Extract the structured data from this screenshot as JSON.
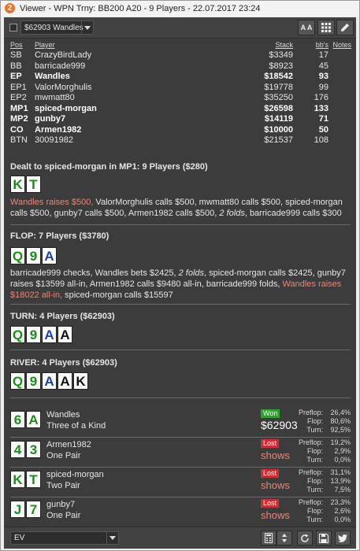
{
  "window": {
    "title": "Viewer - WPN Trny: BB200 A20 - 9 Players - 22.07.2017 23:24",
    "app_icon": "2"
  },
  "toolbar": {
    "hand_select": "$62903 Wandles",
    "btn_aa": "A A"
  },
  "table_header": {
    "pos": "Pos",
    "player": "Player",
    "stack": "Stack",
    "bbs": "bb's",
    "notes": "Notes"
  },
  "players": [
    {
      "pos": "SB",
      "name": "CrazyBirdLady",
      "stack": "$3349",
      "bbs": "17",
      "bold": false
    },
    {
      "pos": "BB",
      "name": "barricade999",
      "stack": "$8923",
      "bbs": "45",
      "bold": false
    },
    {
      "pos": "EP",
      "name": "Wandles",
      "stack": "$18542",
      "bbs": "93",
      "bold": true
    },
    {
      "pos": "EP1",
      "name": "ValorMorghulis",
      "stack": "$19778",
      "bbs": "99",
      "bold": false
    },
    {
      "pos": "EP2",
      "name": "mwmatt80",
      "stack": "$35250",
      "bbs": "176",
      "bold": false
    },
    {
      "pos": "MP1",
      "name": "spiced-morgan",
      "stack": "$26598",
      "bbs": "133",
      "bold": true
    },
    {
      "pos": "MP2",
      "name": "gunby7",
      "stack": "$14119",
      "bbs": "71",
      "bold": true
    },
    {
      "pos": "CO",
      "name": "Armen1982",
      "stack": "$10000",
      "bbs": "50",
      "bold": true
    },
    {
      "pos": "BTN",
      "name": "30091982",
      "stack": "$21537",
      "bbs": "108",
      "bold": false
    }
  ],
  "preflop": {
    "header": "Dealt to spiced-morgan in MP1: 9 Players ($280)",
    "cards": [
      {
        "r": "K",
        "s": "c"
      },
      {
        "r": "T",
        "s": "c"
      }
    ],
    "act_red": "Wandles raises $500,",
    "act_a": " ValorMorghulis calls $500, mwmatt80 calls $500, spiced-morgan calls $500, gunby7 calls $500, Armen1982 calls $500, ",
    "act_it": "2 folds",
    "act_b": ", barricade999 calls $300"
  },
  "flop": {
    "header": "FLOP: 7 Players ($3780)",
    "cards": [
      {
        "r": "Q",
        "s": "c"
      },
      {
        "r": "9",
        "s": "c"
      },
      {
        "r": "A",
        "s": "d"
      }
    ],
    "act_a": "barricade999 checks, Wandles bets $2425, ",
    "act_it": "2 folds",
    "act_b": ", spiced-morgan calls $2425, gunby7 raises $13599 all-in, Armen1982 calls $9480 all-in, barricade999 folds, ",
    "act_red": "Wandles raises $18022 all-in,",
    "act_c": " spiced-morgan calls $15597"
  },
  "turn": {
    "header": "TURN: 4 Players ($62903)",
    "cards": [
      {
        "r": "Q",
        "s": "c"
      },
      {
        "r": "9",
        "s": "c"
      },
      {
        "r": "A",
        "s": "d"
      },
      {
        "r": "A",
        "s": "s"
      }
    ]
  },
  "river": {
    "header": "RIVER: 4 Players ($62903)",
    "cards": [
      {
        "r": "Q",
        "s": "c"
      },
      {
        "r": "9",
        "s": "c"
      },
      {
        "r": "A",
        "s": "d"
      },
      {
        "r": "A",
        "s": "s"
      },
      {
        "r": "K",
        "s": "s"
      }
    ]
  },
  "results": [
    {
      "cards": [
        {
          "r": "6",
          "s": "c"
        },
        {
          "r": "A",
          "s": "c"
        }
      ],
      "name": "Wandles",
      "hand": "Three of a Kind",
      "status": "Won",
      "amount": "$62903",
      "eq": [
        [
          "Preflop:",
          "26,4%"
        ],
        [
          "Flop:",
          "80,6%"
        ],
        [
          "Turn:",
          "92,5%"
        ]
      ]
    },
    {
      "cards": [
        {
          "r": "4",
          "s": "c"
        },
        {
          "r": "3",
          "s": "c"
        }
      ],
      "name": "Armen1982",
      "hand": "One Pair",
      "status": "Lost",
      "amount": "shows",
      "eq": [
        [
          "Preflop:",
          "19,2%"
        ],
        [
          "Flop:",
          "2,9%"
        ],
        [
          "Turn:",
          "0,0%"
        ]
      ]
    },
    {
      "cards": [
        {
          "r": "K",
          "s": "c"
        },
        {
          "r": "T",
          "s": "c"
        }
      ],
      "name": "spiced-morgan",
      "hand": "Two Pair",
      "status": "Lost",
      "amount": "shows",
      "eq": [
        [
          "Preflop:",
          "31,1%"
        ],
        [
          "Flop:",
          "13,9%"
        ],
        [
          "Turn:",
          "7,5%"
        ]
      ]
    },
    {
      "cards": [
        {
          "r": "J",
          "s": "c"
        },
        {
          "r": "7",
          "s": "c"
        }
      ],
      "name": "gunby7",
      "hand": "One Pair",
      "status": "Lost",
      "amount": "shows",
      "eq": [
        [
          "Preflop:",
          "23,3%"
        ],
        [
          "Flop:",
          "2,6%"
        ],
        [
          "Turn:",
          "0,0%"
        ]
      ]
    }
  ],
  "bottom": {
    "select_value": "EV"
  },
  "colors": {
    "panel": "#3c3c3c",
    "won": "#2fa02f",
    "lost": "#c63232",
    "raise": "#e8867a",
    "club": "#1a8c1a",
    "diamond": "#1f3fb8"
  },
  "icons": [
    "app-logo-icon",
    "grid-icon",
    "pencil-icon",
    "calculator-icon",
    "sort-icon",
    "refresh-icon",
    "save-icon",
    "twitter-icon"
  ]
}
